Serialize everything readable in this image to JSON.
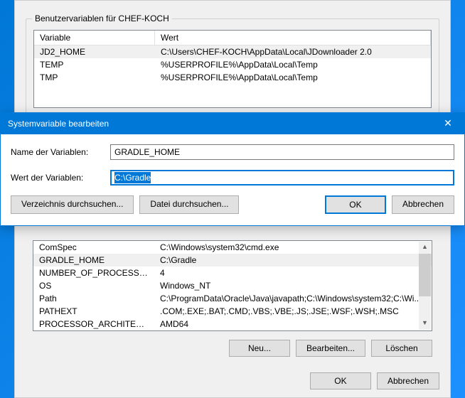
{
  "main": {
    "userVarsLabel": "Benutzervariablen für CHEF-KOCH",
    "columns": {
      "name": "Variable",
      "value": "Wert"
    },
    "userVars": [
      {
        "name": "JD2_HOME",
        "value": "C:\\Users\\CHEF-KOCH\\AppData\\Local\\JDownloader 2.0",
        "selected": true
      },
      {
        "name": "TEMP",
        "value": "%USERPROFILE%\\AppData\\Local\\Temp"
      },
      {
        "name": "TMP",
        "value": "%USERPROFILE%\\AppData\\Local\\Temp"
      }
    ],
    "sysVars": [
      {
        "name": "ComSpec",
        "value": "C:\\Windows\\system32\\cmd.exe"
      },
      {
        "name": "GRADLE_HOME",
        "value": "C:\\Gradle",
        "selected": true
      },
      {
        "name": "NUMBER_OF_PROCESSORS",
        "value": "4"
      },
      {
        "name": "OS",
        "value": "Windows_NT"
      },
      {
        "name": "Path",
        "value": "C:\\ProgramData\\Oracle\\Java\\javapath;C:\\Windows\\system32;C:\\Wi..."
      },
      {
        "name": "PATHEXT",
        "value": ".COM;.EXE;.BAT;.CMD;.VBS;.VBE;.JS;.JSE;.WSF;.WSH;.MSC"
      },
      {
        "name": "PROCESSOR_ARCHITECTURE",
        "value": "AMD64"
      }
    ],
    "buttons": {
      "new": "Neu...",
      "edit": "Bearbeiten...",
      "delete": "Löschen",
      "ok": "OK",
      "cancel": "Abbrechen"
    }
  },
  "editDialog": {
    "title": "Systemvariable bearbeiten",
    "nameLabel": "Name der Variablen:",
    "valueLabel": "Wert der Variablen:",
    "name": "GRADLE_HOME",
    "value": "C:\\Gradle",
    "browseDir": "Verzeichnis durchsuchen...",
    "browseFile": "Datei durchsuchen...",
    "ok": "OK",
    "cancel": "Abbrechen"
  }
}
